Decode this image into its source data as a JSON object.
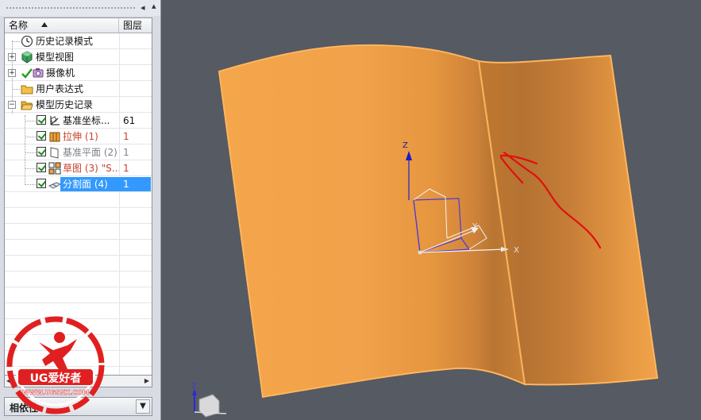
{
  "navigator": {
    "columns": {
      "name": "名称",
      "layer": "图层"
    },
    "nodes": [
      {
        "label": "历史记录模式",
        "layer": "",
        "icon": "clock-icon"
      },
      {
        "label": "模型视图",
        "layer": "",
        "icon": "model-views-icon"
      },
      {
        "label": "摄像机",
        "layer": "",
        "icon": "camera-icon"
      },
      {
        "label": "用户表达式",
        "layer": "",
        "icon": "folder-icon"
      },
      {
        "label": "模型历史记录",
        "layer": "",
        "icon": "folder-open-icon"
      },
      {
        "label": "基准坐标...",
        "layer": "61",
        "icon": "datum-csys-icon"
      },
      {
        "label": "拉伸 (1)",
        "layer": "1",
        "icon": "extrude-icon"
      },
      {
        "label": "基准平面 (2)",
        "layer": "1",
        "icon": "datum-plane-icon"
      },
      {
        "label": "草图 (3) \"S...",
        "layer": "1",
        "icon": "sketch-icon"
      },
      {
        "label": "分割面 (4)",
        "layer": "1",
        "icon": "divide-face-icon"
      }
    ],
    "dependencies_label": "相依性"
  },
  "viewport": {
    "axis_labels": {
      "z": "Z",
      "y": "Y",
      "x": "X"
    },
    "mini_triad_label": "Z",
    "surface_color": "#f2a54a",
    "annotation_color": "#e01010"
  },
  "watermark": {
    "brand": "UG爱好者",
    "url": "WWW.UGSNX.COM"
  }
}
